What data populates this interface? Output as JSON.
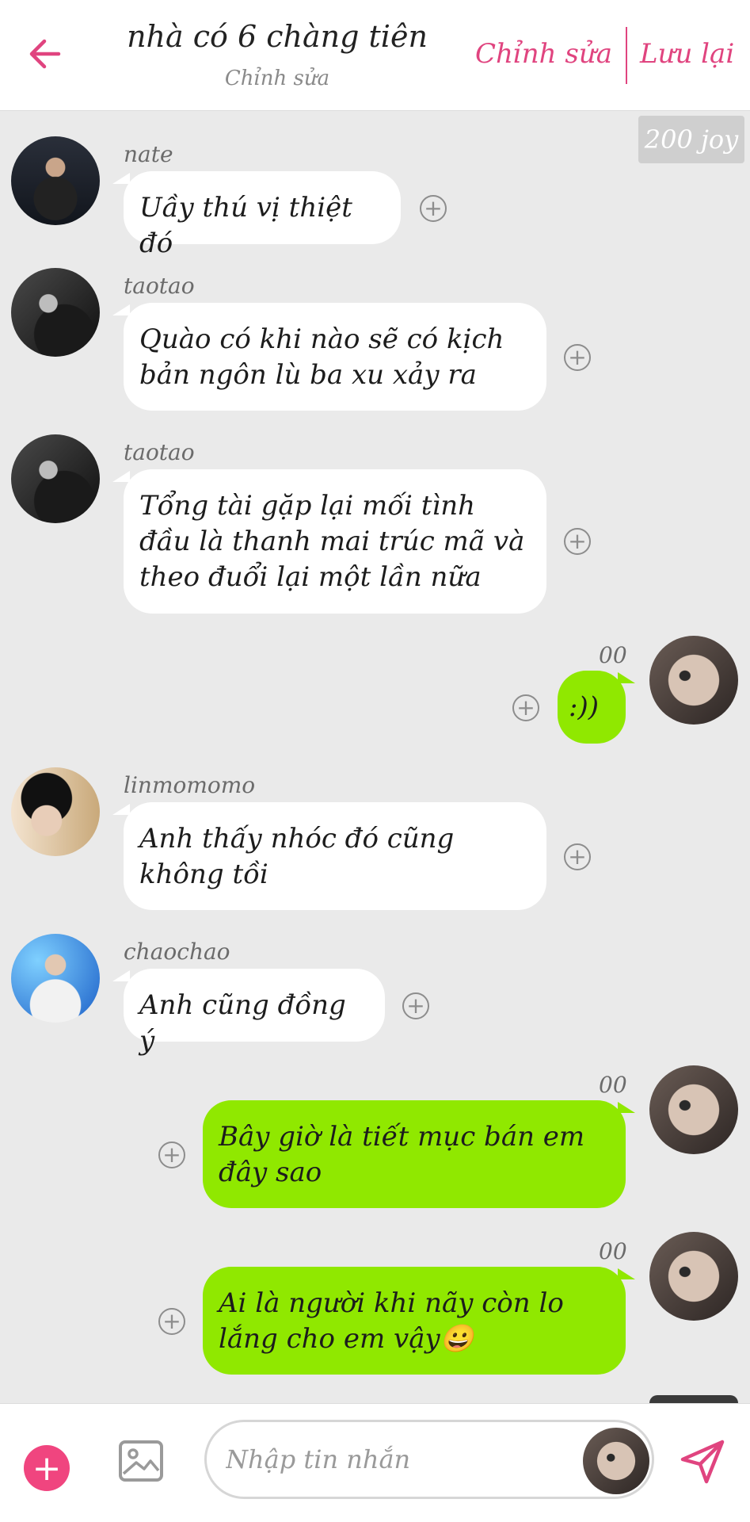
{
  "header": {
    "title": "nhà có 6 chàng tiên",
    "subtitle": "Chỉnh sửa",
    "edit_label": "Chỉnh sửa",
    "save_label": "Lưu lại"
  },
  "joy_badge": "200 joy",
  "messages": [
    {
      "sender": "nate",
      "text": "Uầy thú vị thiệt đó"
    },
    {
      "sender": "taotao",
      "text": "Quào có khi nào sẽ có kịch bản ngôn lù ba xu xảy ra"
    },
    {
      "sender": "taotao",
      "text": "Tổng tài gặp lại mối tình đầu là thanh mai trúc mã và theo đuổi lại một lần nữa"
    },
    {
      "sender": "00",
      "text": ":))"
    },
    {
      "sender": "linmomomo",
      "text": "Anh thấy nhóc đó cũng không tồi"
    },
    {
      "sender": "chaochao",
      "text": "Anh cũng đồng ý"
    },
    {
      "sender": "00",
      "text": "Bây giờ là tiết mục bán em đây sao"
    },
    {
      "sender": "00",
      "text": "Ai là người khi nãy còn lo lắng cho em vậy😀"
    }
  ],
  "input": {
    "placeholder": "Nhập tin nhắn"
  },
  "colors": {
    "accent": "#e0447f",
    "out_bubble": "#90e800",
    "in_bubble": "#ffffff",
    "background": "#eaeaea"
  },
  "icons": [
    "back-arrow-icon",
    "add-circle-icon",
    "image-icon",
    "send-icon"
  ]
}
